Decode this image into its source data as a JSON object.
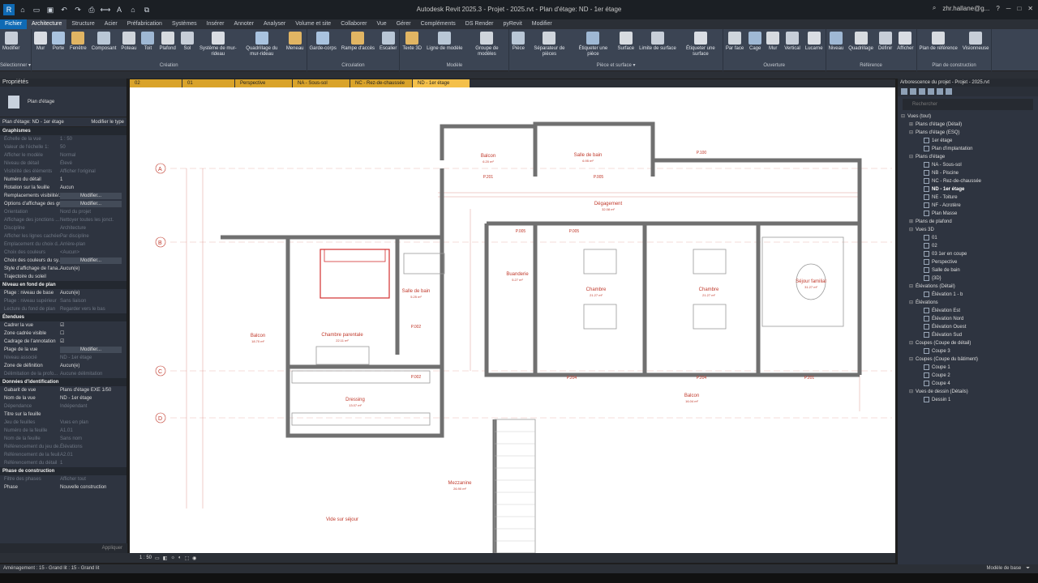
{
  "window": {
    "title": "Autodesk Revit 2025.3 - Projet - 2025.rvt - Plan d'étage: ND - 1er étage",
    "user": "zhr.hallane@g...",
    "search_icon": "search-icon"
  },
  "tabs": [
    "Fichier",
    "Architecture",
    "Structure",
    "Acier",
    "Préfabrication",
    "Systèmes",
    "Insérer",
    "Annoter",
    "Analyser",
    "Volume et site",
    "Collaborer",
    "Vue",
    "Gérer",
    "Compléments",
    "DS Render",
    "pyRevit",
    "Modifier"
  ],
  "ribbon": {
    "groups": [
      {
        "label": "Sélectionner ▾",
        "buttons": [
          "Modifier"
        ]
      },
      {
        "label": "Création",
        "buttons": [
          "Mur",
          "Porte",
          "Fenêtre",
          "Composant",
          "Poteau",
          "Toit",
          "Plafond",
          "Sol",
          "Système de mur-rideau",
          "Quadrillage du mur-rideau",
          "Meneau"
        ]
      },
      {
        "label": "Circulation",
        "buttons": [
          "Garde-corps",
          "Rampe d'accès",
          "Escalier"
        ]
      },
      {
        "label": "Modèle",
        "buttons": [
          "Texte 3D",
          "Ligne de modèle",
          "Groupe de modèles"
        ]
      },
      {
        "label": "Pièce et surface ▾",
        "buttons": [
          "Pièce",
          "Séparateur de pièces",
          "Étiqueter une pièce",
          "Surface",
          "Limite de surface",
          "Étiqueter une surface"
        ]
      },
      {
        "label": "Ouverture",
        "buttons": [
          "Par face",
          "Cage",
          "Mur",
          "Vertical",
          "Lucarne"
        ]
      },
      {
        "label": "Référence",
        "buttons": [
          "Niveau",
          "Quadrillage",
          "Définir",
          "Afficher"
        ]
      },
      {
        "label": "Plan de construction",
        "buttons": [
          "Plan de référence",
          "Visionneuse"
        ]
      }
    ]
  },
  "properties": {
    "title": "Propriétés",
    "type_name": "Plan d'étage",
    "instance": "Plan d'étage: ND - 1er étage",
    "edit_type": "Modifier le type",
    "sections": [
      {
        "name": "Graphismes",
        "rows": [
          [
            "Échelle de la vue",
            "1 : 50",
            1
          ],
          [
            "Valeur de l'échelle    1:",
            "50",
            1
          ],
          [
            "Afficher le modèle",
            "Normal",
            1
          ],
          [
            "Niveau de détail",
            "Élevé",
            1
          ],
          [
            "Visibilité des éléments",
            "Afficher l'original",
            1
          ],
          [
            "Numéro du détail",
            "1",
            0
          ],
          [
            "Rotation sur la feuille",
            "Aucun",
            0
          ],
          [
            "Remplacements visibilité/...",
            "Modifier...",
            0
          ],
          [
            "Options d'affichage des gr...",
            "Modifier...",
            0
          ],
          [
            "Orientation",
            "Nord du projet",
            1
          ],
          [
            "Affichage des jonctions ...",
            "Nettoyer toutes les jonct.",
            1
          ],
          [
            "Discipline",
            "Architecture",
            1
          ],
          [
            "Afficher les lignes cachées",
            "Par discipline",
            1
          ],
          [
            "Emplacement du choix d...",
            "Arrière-plan",
            1
          ],
          [
            "Choix des couleurs",
            "<Aucun>",
            1
          ],
          [
            "Choix des couleurs du sy...",
            "Modifier...",
            0
          ],
          [
            "Style d'affichage de l'ana...",
            "Aucun(e)",
            0
          ],
          [
            "Trajectoire du soleil",
            "",
            0
          ]
        ]
      },
      {
        "name": "Niveau en fond de plan",
        "rows": [
          [
            "Plage : niveau de base",
            "Aucun(e)",
            0
          ],
          [
            "Plage : niveau supérieur",
            "Sans liaison",
            1
          ],
          [
            "Lecture du fond de plan",
            "Regarder vers le bas",
            1
          ]
        ]
      },
      {
        "name": "Étendues",
        "rows": [
          [
            "Cadrer la vue",
            "☑",
            0
          ],
          [
            "Zone cadrée visible",
            "☐",
            0
          ],
          [
            "Cadrage de l'annotation",
            "☑",
            0
          ],
          [
            "Plage de la vue",
            "Modifier...",
            0
          ],
          [
            "Niveau associé",
            "ND - 1er étage",
            1
          ],
          [
            "Zone de définition",
            "Aucun(e)",
            0
          ],
          [
            "Délimitation de la profo...",
            "Aucune délimitation",
            1
          ]
        ]
      },
      {
        "name": "Données d'identification",
        "rows": [
          [
            "Gabarit de vue",
            "Plans d'étage EXE 1/50",
            0
          ],
          [
            "Nom de la vue",
            "ND - 1er étage",
            0
          ],
          [
            "Dépendance",
            "Indépendant",
            1
          ],
          [
            "Titre sur la feuille",
            "",
            0
          ],
          [
            "Jeu de feuilles",
            "Vues en plan",
            1
          ],
          [
            "Numéro de la feuille",
            "A1.01",
            1
          ],
          [
            "Nom de la feuille",
            "Sans nom",
            1
          ],
          [
            "Référencement du jeu de...",
            "Élévations",
            1
          ],
          [
            "Référencement de la feuil...",
            "A2.01",
            1
          ],
          [
            "Référencement du détail",
            "1",
            1
          ]
        ]
      },
      {
        "name": "Phase de construction",
        "rows": [
          [
            "Filtre des phases",
            "Afficher tout",
            1
          ],
          [
            "Phase",
            "Nouvelle construction",
            0
          ]
        ]
      }
    ],
    "apply": "Appliquer"
  },
  "view_tabs": [
    "02",
    "01",
    "Perspective",
    "NA - Sous-sol",
    "NC - Rez-de-chaussée",
    "ND - 1er étage"
  ],
  "plan": {
    "rooms": [
      {
        "name": "Balcon",
        "area": "6.20 m²"
      },
      {
        "name": "Salle de bain",
        "area": "6.95 m²"
      },
      {
        "name": "Dégagement",
        "area": "32.08 m²"
      },
      {
        "name": "Balcon",
        "area": "18.70 m²"
      },
      {
        "name": "Chambre parentale",
        "area": "22.11 m²"
      },
      {
        "name": "Salle de bain",
        "area": "5.25 m²"
      },
      {
        "name": "Buanderie",
        "area": "5.27 m²"
      },
      {
        "name": "Chambre",
        "area": "21.27 m²"
      },
      {
        "name": "Chambre",
        "area": "21.27 m²"
      },
      {
        "name": "Séjour familial",
        "area": "31.27 m²"
      },
      {
        "name": "Dressing",
        "area": "13.07 m²"
      },
      {
        "name": "Balcon",
        "area": "16.04 m²"
      },
      {
        "name": "Mezzanine",
        "area": "26.90 m²"
      }
    ],
    "note": "Vide sur séjour",
    "grids": [
      "A",
      "B",
      "C",
      "D"
    ],
    "tags": [
      "P.100",
      "P.201",
      "P.005",
      "P.005",
      "P.005",
      "P.002",
      "P.002",
      "P.204",
      "P.204",
      "P.201"
    ]
  },
  "view_control": {
    "scale": "1 : 50"
  },
  "status": {
    "text": "Aménagement : 15 - Grand lit : 15 - Grand lit",
    "model": "Modèle de base"
  },
  "browser": {
    "title": "Arborescence du projet - Projet - 2025.rvt",
    "search": "Rechercher",
    "nodes": [
      [
        "Vues (tout)",
        0,
        "⊟",
        0
      ],
      [
        "Plans d'étage (Détail)",
        1,
        "⊞",
        0
      ],
      [
        "Plans d'étage (ESQ)",
        1,
        "⊟",
        0
      ],
      [
        "1er étage",
        2,
        "",
        0
      ],
      [
        "Plan d'implantation",
        2,
        "",
        0
      ],
      [
        "Plans d'étage",
        1,
        "⊟",
        0
      ],
      [
        "NA - Sous-sol",
        2,
        "",
        0
      ],
      [
        "NB - Piscine",
        2,
        "",
        0
      ],
      [
        "NC - Rez-de-chaussée",
        2,
        "",
        0
      ],
      [
        "ND - 1er étage",
        2,
        "",
        1
      ],
      [
        "NE - Toiture",
        2,
        "",
        0
      ],
      [
        "NF - Acrotère",
        2,
        "",
        0
      ],
      [
        "Plan Masse",
        2,
        "",
        0
      ],
      [
        "Plans de plafond",
        1,
        "⊞",
        0
      ],
      [
        "Vues 3D",
        1,
        "⊟",
        0
      ],
      [
        "01",
        2,
        "",
        0
      ],
      [
        "02",
        2,
        "",
        0
      ],
      [
        "03 1er en coupe",
        2,
        "",
        0
      ],
      [
        "Perspective",
        2,
        "",
        0
      ],
      [
        "Salle de bain",
        2,
        "",
        0
      ],
      [
        "{3D}",
        2,
        "",
        0
      ],
      [
        "Élévations (Détail)",
        1,
        "⊟",
        0
      ],
      [
        "Élévation 1 - b",
        2,
        "",
        0
      ],
      [
        "Élévations",
        1,
        "⊟",
        0
      ],
      [
        "Élévation Est",
        2,
        "",
        0
      ],
      [
        "Élévation Nord",
        2,
        "",
        0
      ],
      [
        "Élévation Ouest",
        2,
        "",
        0
      ],
      [
        "Élévation Sud",
        2,
        "",
        0
      ],
      [
        "Coupes (Coupe de détail)",
        1,
        "⊟",
        0
      ],
      [
        "Coupe 3",
        2,
        "",
        0
      ],
      [
        "Coupes (Coupe du bâtiment)",
        1,
        "⊟",
        0
      ],
      [
        "Coupe 1",
        2,
        "",
        0
      ],
      [
        "Coupe 2",
        2,
        "",
        0
      ],
      [
        "Coupe 4",
        2,
        "",
        0
      ],
      [
        "Vues de dessin (Détails)",
        1,
        "⊟",
        0
      ],
      [
        "Dessin 1",
        2,
        "",
        0
      ]
    ]
  },
  "colors": {
    "accent": "#0f6ab4",
    "tab_active": "#f4c04a",
    "wall": "#8a8a8a",
    "annotation": "#c0392b"
  }
}
